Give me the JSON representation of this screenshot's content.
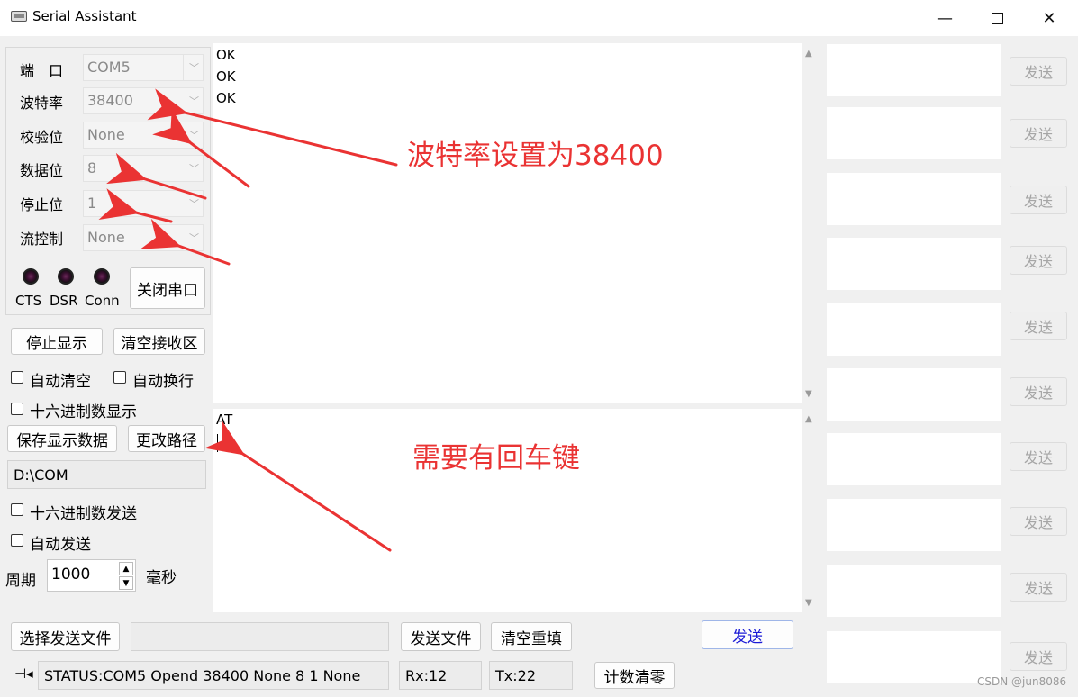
{
  "window": {
    "title": "Serial Assistant",
    "min_label": "—",
    "close_label": "✕"
  },
  "port_settings": {
    "port_label": "端　口",
    "port_value": "COM5",
    "baud_label": "波特率",
    "baud_value": "38400",
    "parity_label": "校验位",
    "parity_value": "None",
    "databits_label": "数据位",
    "databits_value": "8",
    "stopbits_label": "停止位",
    "stopbits_value": "1",
    "flow_label": "流控制",
    "flow_value": "None"
  },
  "indicators": {
    "cts": "CTS",
    "dsr": "DSR",
    "conn": "Conn"
  },
  "buttons": {
    "close_port": "关闭串口",
    "stop_display": "停止显示",
    "clear_receive": "清空接收区",
    "save_display": "保存显示数据",
    "change_path": "更改路径",
    "select_file": "选择发送文件",
    "send_file": "发送文件",
    "clear_reset": "清空重填",
    "send": "发送",
    "reset_count": "计数清零"
  },
  "options": {
    "auto_clear": "自动清空",
    "auto_wrap": "自动换行",
    "hex_display": "十六进制数显示",
    "hex_send": "十六进制数发送",
    "auto_send": "自动发送"
  },
  "path": "D:\\COM",
  "period": {
    "label": "周期",
    "value": "1000",
    "unit": "毫秒"
  },
  "receive": {
    "lines": [
      "OK",
      "OK",
      "OK"
    ]
  },
  "send_area": {
    "text": "AT"
  },
  "multi_send": {
    "button_label": "发送"
  },
  "status": {
    "text": "STATUS:COM5 Opend 38400 None 8 1 None",
    "rx": "Rx:12",
    "tx": "Tx:22"
  },
  "annotations": {
    "baud_note": "波特率设置为38400",
    "enter_note": "需要有回车键",
    "color": "#ea3333"
  },
  "watermark": "CSDN @jun8086",
  "colors": {
    "send_text": "#1b1bd6",
    "annotation": "#ea3333"
  }
}
